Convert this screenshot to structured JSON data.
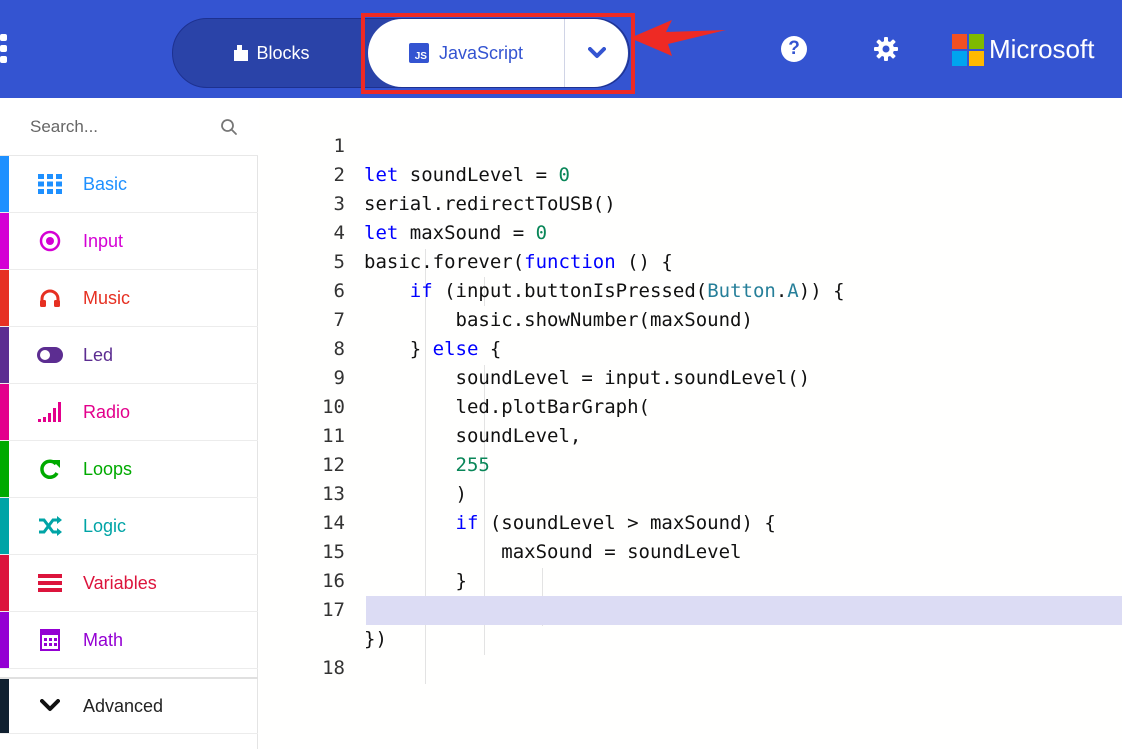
{
  "header": {
    "blocks_label": "Blocks",
    "javascript_label": "JavaScript",
    "js_badge": "JS",
    "help_label": "?",
    "brand": "Microsoft",
    "colors": {
      "bar": "#3454d1",
      "highlight": "#ee2a24"
    }
  },
  "search": {
    "placeholder": "Search..."
  },
  "categories": [
    {
      "label": "Basic",
      "color": "#1e90ff",
      "icon": "grid-icon"
    },
    {
      "label": "Input",
      "color": "#d400d4",
      "icon": "target-icon"
    },
    {
      "label": "Music",
      "color": "#e63022",
      "icon": "headphones-icon"
    },
    {
      "label": "Led",
      "color": "#5c2d91",
      "icon": "toggle-icon"
    },
    {
      "label": "Radio",
      "color": "#e3008c",
      "icon": "signal-bars-icon"
    },
    {
      "label": "Loops",
      "color": "#00aa00",
      "icon": "refresh-icon"
    },
    {
      "label": "Logic",
      "color": "#00a4a6",
      "icon": "shuffle-icon"
    },
    {
      "label": "Variables",
      "color": "#dc143c",
      "icon": "lines-icon"
    },
    {
      "label": "Math",
      "color": "#9400d3",
      "icon": "calculator-icon"
    },
    {
      "label": "Advanced",
      "color": "#102030",
      "icon": "chevron-down-icon"
    }
  ],
  "code_lines": [
    {
      "n": "1",
      "text": "let soundLevel = 0"
    },
    {
      "n": "2",
      "text": "serial.redirectToUSB()"
    },
    {
      "n": "3",
      "text": "let maxSound = 0"
    },
    {
      "n": "4",
      "text": "basic.forever(function () {"
    },
    {
      "n": "5",
      "text": "    if (input.buttonIsPressed(Button.A)) {"
    },
    {
      "n": "6",
      "text": "        basic.showNumber(maxSound)"
    },
    {
      "n": "7",
      "text": "    } else {"
    },
    {
      "n": "8",
      "text": "        soundLevel = input.soundLevel()"
    },
    {
      "n": "9",
      "text": "        led.plotBarGraph("
    },
    {
      "n": "10",
      "text": "        soundLevel,"
    },
    {
      "n": "11",
      "text": "        255"
    },
    {
      "n": "12",
      "text": "        )"
    },
    {
      "n": "13",
      "text": "        if (soundLevel > maxSound) {"
    },
    {
      "n": "14",
      "text": "            maxSound = soundLevel"
    },
    {
      "n": "15",
      "text": "        }"
    },
    {
      "n": "16",
      "text": "    }"
    },
    {
      "n": "17",
      "text": "})"
    },
    {
      "n": "18",
      "text": ""
    }
  ]
}
